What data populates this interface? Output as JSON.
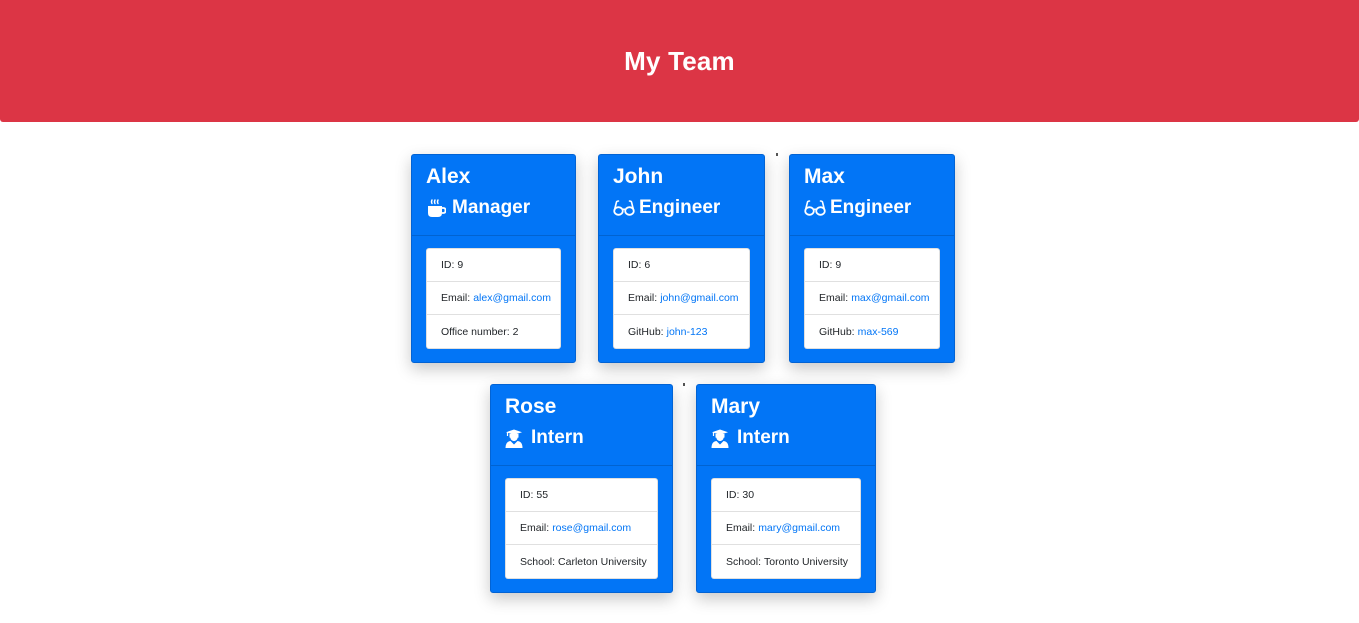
{
  "header": {
    "title": "My Team",
    "color": "#dc3545"
  },
  "accent": "#0275f6",
  "cards": [
    {
      "name": "Alex",
      "role": "Manager",
      "icon": "coffee-mug-icon",
      "id_label": "ID:",
      "id": "9",
      "email_label": "Email:",
      "email": "alex@gmail.com",
      "extra_label": "Office number:",
      "extra": "2"
    },
    {
      "name": "John",
      "role": "Engineer",
      "icon": "glasses-icon",
      "id_label": "ID:",
      "id": "6",
      "email_label": "Email:",
      "email": "john@gmail.com",
      "extra_label": "GitHub:",
      "extra": "john-123"
    },
    {
      "name": "Max",
      "role": "Engineer",
      "icon": "glasses-icon",
      "id_label": "ID:",
      "id": "9",
      "email_label": "Email:",
      "email": "max@gmail.com",
      "extra_label": "GitHub:",
      "extra": "max-569"
    },
    {
      "name": "Rose",
      "role": "Intern",
      "icon": "graduate-icon",
      "id_label": "ID:",
      "id": "55",
      "email_label": "Email:",
      "email": "rose@gmail.com",
      "extra_label": "School:",
      "extra": "Carleton University"
    },
    {
      "name": "Mary",
      "role": "Intern",
      "icon": "graduate-icon",
      "id_label": "ID:",
      "id": "30",
      "email_label": "Email:",
      "email": "mary@gmail.com",
      "extra_label": "School:",
      "extra": "Toronto University"
    }
  ]
}
